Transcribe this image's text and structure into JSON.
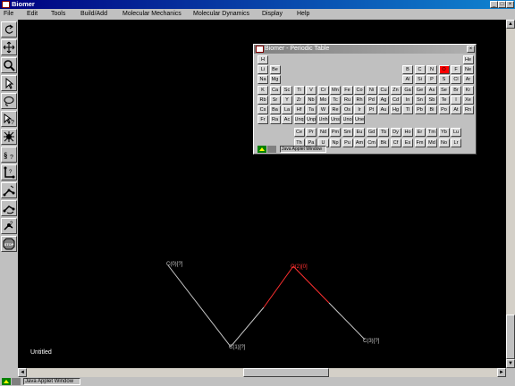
{
  "app": {
    "title": "Biomer"
  },
  "menu": [
    "File",
    "Edit",
    "Tools",
    "Build/Add",
    "Molecular Mechanics",
    "Molecular Dynamics",
    "Display",
    "Help"
  ],
  "toolbar_icons": [
    "undo-icon",
    "move-icon",
    "zoom-icon",
    "select-arrow-icon",
    "lasso-icon",
    "query-select-icon",
    "add-atom-icon",
    "measure-distance-icon",
    "measure-angle-icon",
    "measure-dihedral-icon",
    "rotate-icon",
    "bond-query-icon",
    "stop-icon"
  ],
  "canvas": {
    "status_label": "Untitled",
    "atoms": [
      {
        "label": "C(0)[?]",
        "color": "#c8c8c8"
      },
      {
        "label": "C(1)[?]",
        "color": "#c8c8c8"
      },
      {
        "label": "O(2)[0]",
        "color": "#ff3030"
      },
      {
        "label": "C(3)[?]",
        "color": "#c8c8c8"
      }
    ]
  },
  "statusbar": {
    "label": "Java Applet Window"
  },
  "periodic": {
    "title": "Biomer - Periodic Table",
    "selected": "O",
    "selected_color": "#ff0000",
    "rows": [
      [
        "H",
        "He"
      ],
      [
        "Li",
        "Be",
        "B",
        "C",
        "N",
        "O",
        "F",
        "Ne"
      ],
      [
        "Na",
        "Mg",
        "Al",
        "Si",
        "P",
        "S",
        "Cl",
        "Ar"
      ],
      [
        "K",
        "Ca",
        "Sc",
        "Ti",
        "V",
        "Cr",
        "Mn",
        "Fe",
        "Co",
        "Ni",
        "Cu",
        "Zn",
        "Ga",
        "Ge",
        "As",
        "Se",
        "Br",
        "Kr"
      ],
      [
        "Rb",
        "Sr",
        "Y",
        "Zr",
        "Nb",
        "Mo",
        "Tc",
        "Ru",
        "Rh",
        "Pd",
        "Ag",
        "Cd",
        "In",
        "Sn",
        "Sb",
        "Te",
        "I",
        "Xe"
      ],
      [
        "Cs",
        "Ba",
        "La",
        "Hf",
        "Ta",
        "W",
        "Re",
        "Os",
        "Ir",
        "Pt",
        "Au",
        "Hg",
        "Tl",
        "Pb",
        "Bi",
        "Po",
        "At",
        "Rn"
      ],
      [
        "Fr",
        "Ra",
        "Ac",
        "Unq",
        "Unp",
        "Unh",
        "Uns",
        "Uno",
        "Une"
      ],
      [
        "Ce",
        "Pr",
        "Nd",
        "Pm",
        "Sm",
        "Eu",
        "Gd",
        "Tb",
        "Dy",
        "Ho",
        "Er",
        "Tm",
        "Yb",
        "Lu"
      ],
      [
        "Th",
        "Pa",
        "U",
        "Np",
        "Pu",
        "Am",
        "Cm",
        "Bk",
        "Cf",
        "Es",
        "Fm",
        "Md",
        "No",
        "Lr"
      ]
    ],
    "status_label": "Java Applet Window"
  }
}
